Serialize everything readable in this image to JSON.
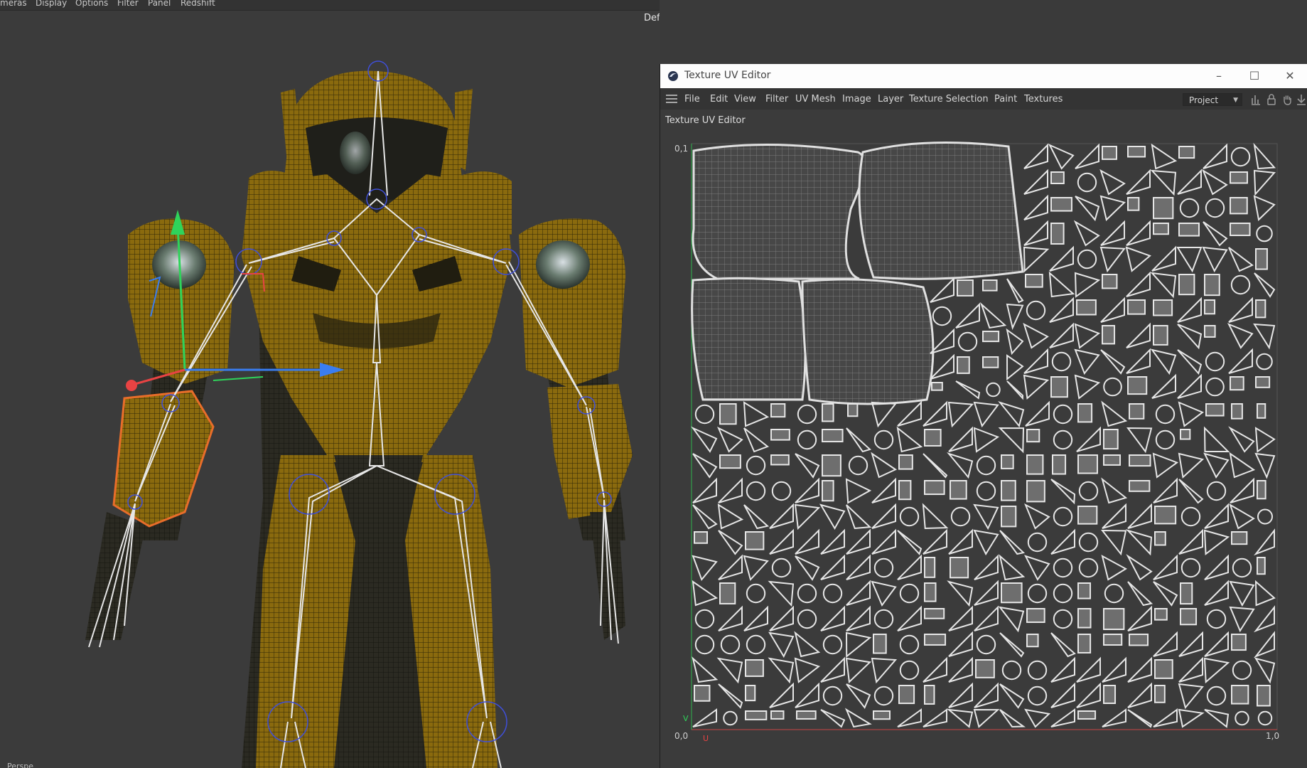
{
  "viewport": {
    "menu": [
      "meras",
      "Display",
      "Options",
      "Filter",
      "Panel",
      "Redshift"
    ],
    "camera_label": "Default Camera",
    "bottom_label": "Perspe"
  },
  "uv_editor": {
    "title": "Texture UV Editor",
    "window_controls": {
      "minimize": "–",
      "maximize": "☐",
      "close": "✕"
    },
    "menu": [
      "File",
      "Edit",
      "View",
      "Filter",
      "UV Mesh",
      "Image",
      "Layer",
      "Texture Selection",
      "Paint",
      "Textures"
    ],
    "project_select": "Project",
    "panel_label": "Texture UV Editor",
    "axis": {
      "top_left": "0,1",
      "bottom_left": "0,0",
      "bottom_right": "1,0",
      "u": "U",
      "v": "V"
    }
  },
  "colors": {
    "armor": "#8a6a0e",
    "armor_dark": "#2a2612",
    "bone": "#e6e6e6",
    "joint": "#3f4fd9",
    "axis_x": "#3a7df0",
    "axis_y": "#2fd35a",
    "axis_z": "#e84343",
    "selection": "#e86d2a",
    "uv_bg": "#3b3b3b",
    "uv_line": "#dcdcdc"
  }
}
